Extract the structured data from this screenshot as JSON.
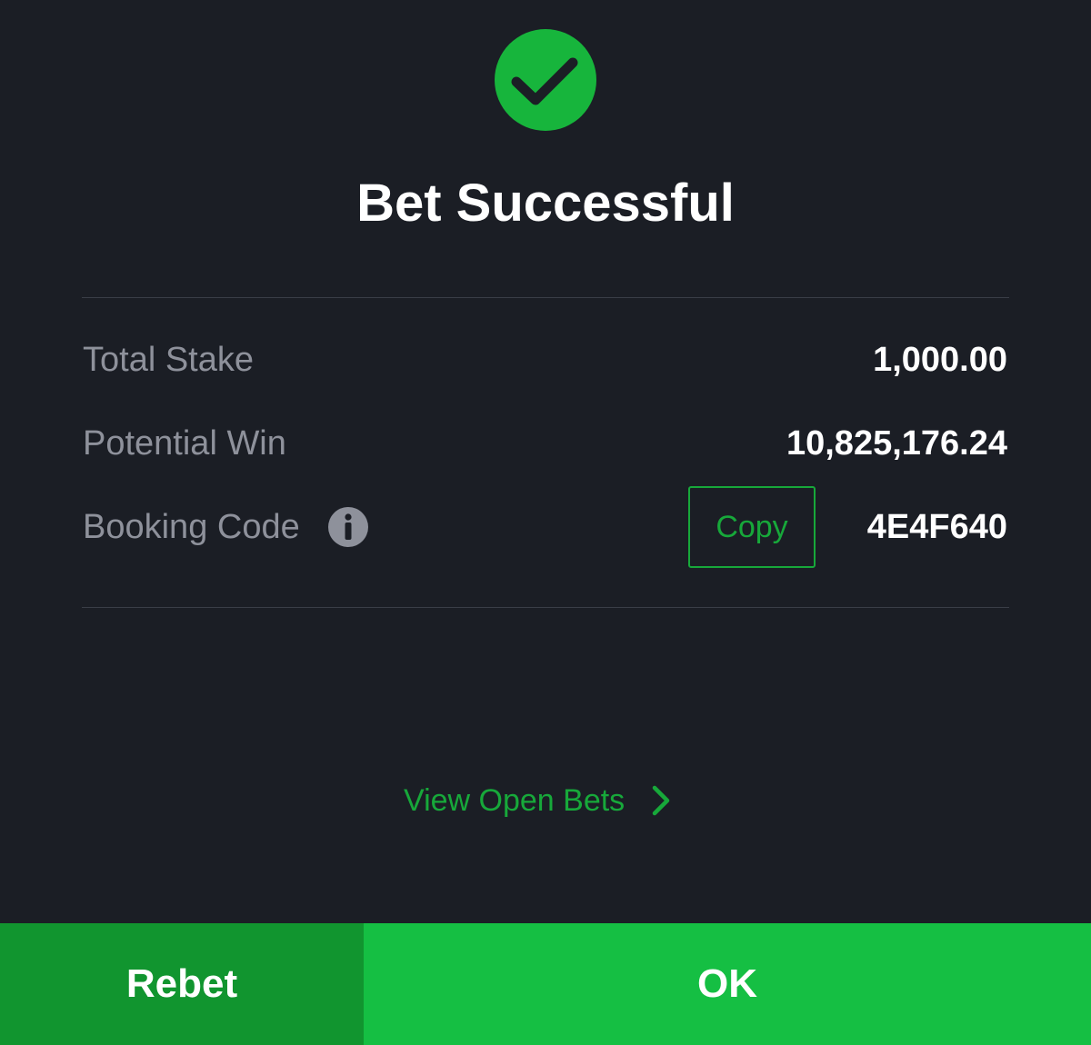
{
  "status": {
    "icon": "checkmark-circle-icon",
    "title": "Bet Successful",
    "accent_color": "#17b53c"
  },
  "summary": {
    "total_stake": {
      "label": "Total Stake",
      "value": "1,000.00"
    },
    "potential_win": {
      "label": "Potential Win",
      "value": "10,825,176.24"
    },
    "booking_code": {
      "label": "Booking Code",
      "info_icon": "info-icon",
      "copy_label": "Copy",
      "value": "4E4F640"
    }
  },
  "links": {
    "view_open_bets": "View Open Bets",
    "chevron_icon": "chevron-right-icon"
  },
  "actions": {
    "rebet_label": "Rebet",
    "ok_label": "OK",
    "rebet_color": "#11952f",
    "ok_color": "#15bf43"
  }
}
